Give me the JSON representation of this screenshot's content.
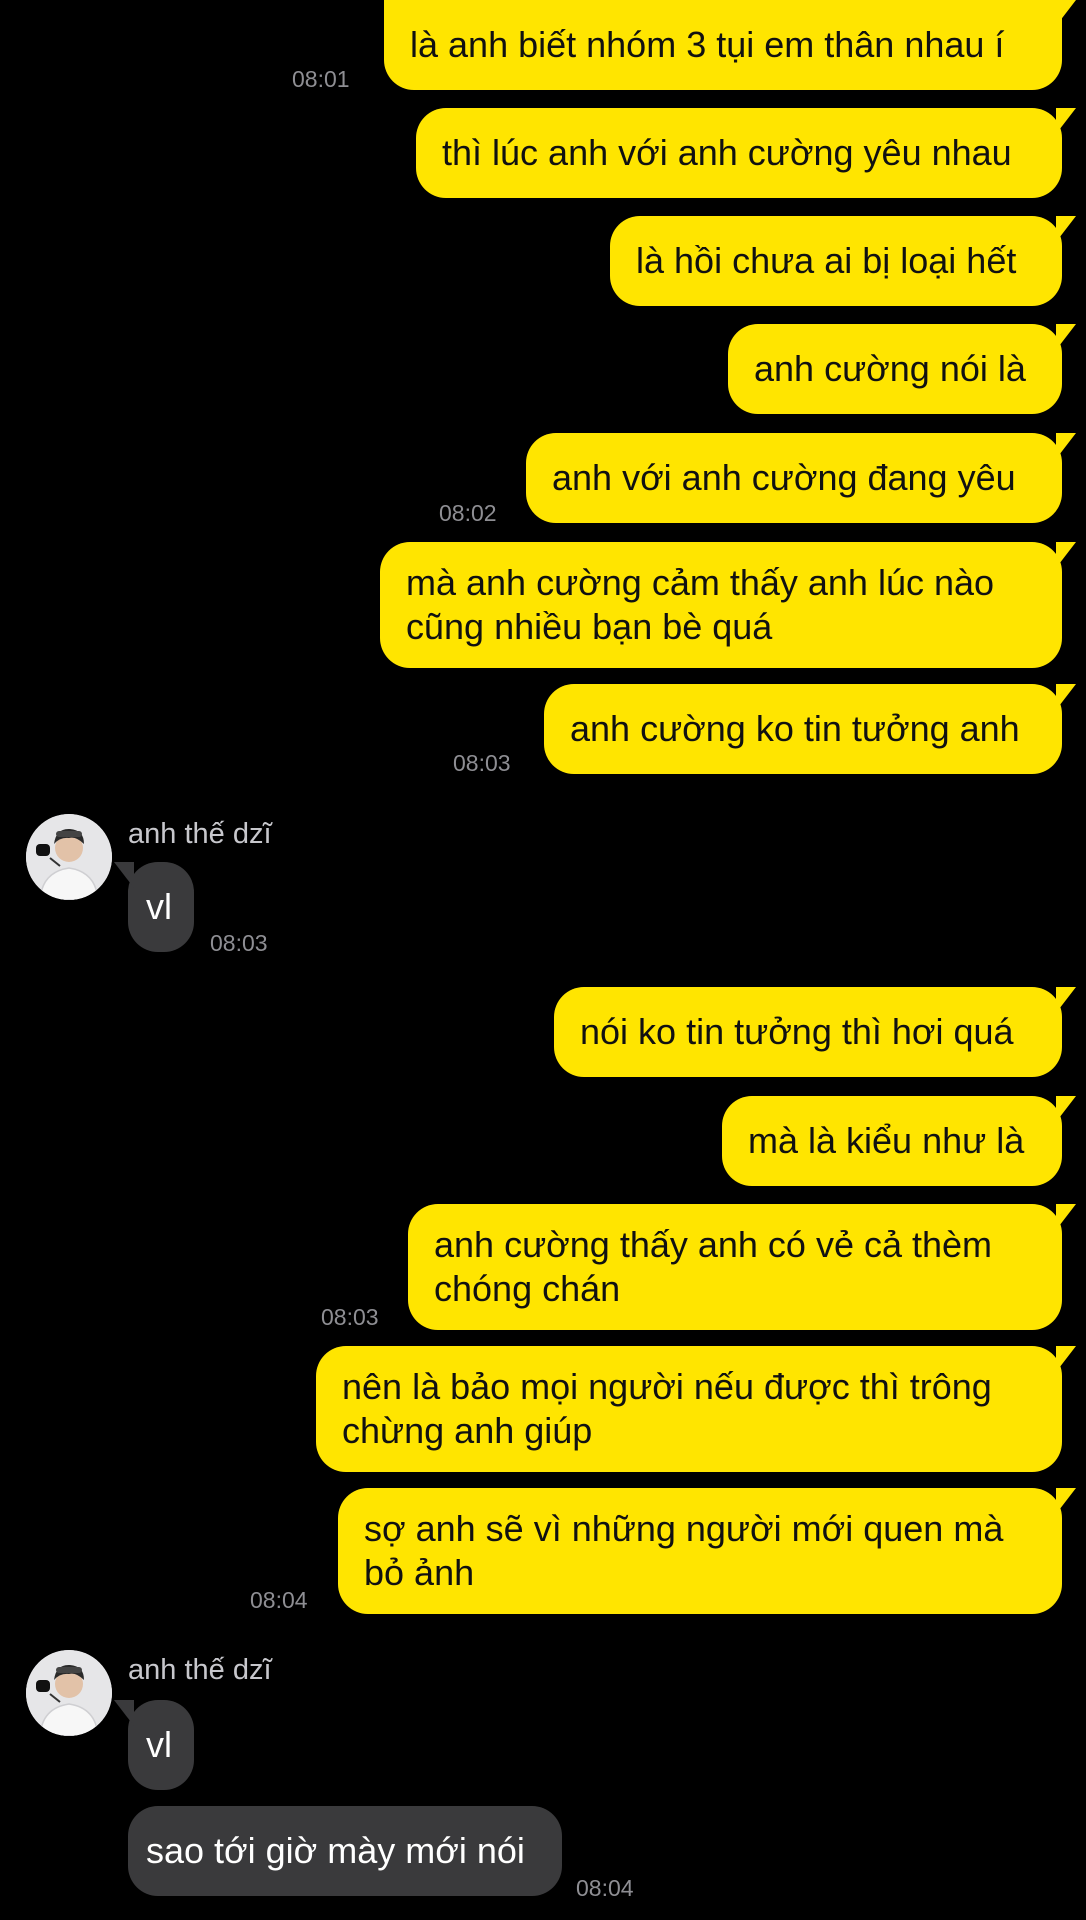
{
  "accent_color": "#ffe500",
  "incoming_color": "#3a3a3c",
  "messages": [
    {
      "text": "là anh biết nhóm 3 tụi em thân nhau í",
      "time": "08:01"
    },
    {
      "text": "thì lúc anh với anh cường yêu nhau"
    },
    {
      "text": "là hồi chưa ai bị loại hết"
    },
    {
      "text": "anh cường nói là"
    },
    {
      "text": "anh với anh cường đang yêu",
      "time": "08:02"
    },
    {
      "text": "mà anh cường cảm thấy anh lúc nào cũng nhiều bạn bè quá"
    },
    {
      "text": "anh cường ko tin tưởng anh",
      "time": "08:03"
    },
    {
      "sender": "anh thế dzĩ",
      "text": "vl",
      "time": "08:03"
    },
    {
      "text": "nói ko tin tưởng thì hơi quá"
    },
    {
      "text": "mà là kiểu như là"
    },
    {
      "text": "anh cường thấy anh có vẻ cả thèm chóng chán",
      "time": "08:03"
    },
    {
      "text": "nên là bảo mọi người nếu được thì trông chừng anh giúp"
    },
    {
      "text": "sợ anh sẽ vì những người mới quen mà bỏ ảnh",
      "time": "08:04"
    },
    {
      "sender": "anh thế dzĩ",
      "text": "vl"
    },
    {
      "text": "sao tới giờ mày mới nói",
      "time": "08:04"
    }
  ]
}
